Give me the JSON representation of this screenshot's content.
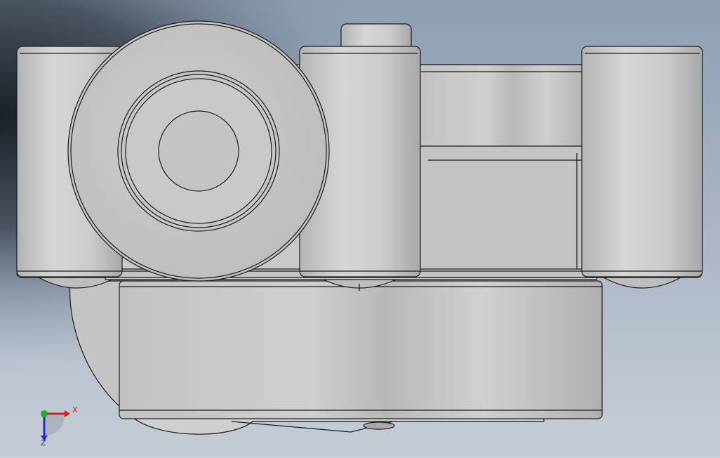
{
  "viewport": {
    "background_top": "#8fa0b4",
    "background_bottom": "#c9d0d9",
    "background_shadow": "#1f242b",
    "part_color": "#c8c8c8",
    "edge_color": "#1c1c1c"
  },
  "triad": {
    "x_label": "X",
    "z_label": "Z",
    "x_color": "#d42020",
    "y_color": "#20b020",
    "z_color": "#2030c8"
  }
}
